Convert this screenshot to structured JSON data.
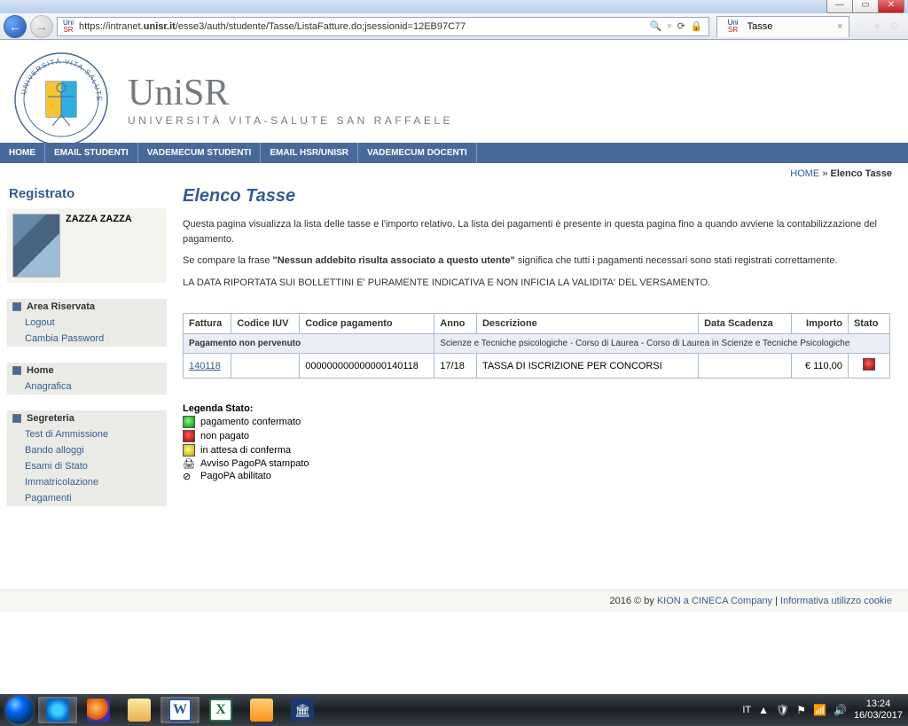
{
  "window": {
    "min": "—",
    "max": "▭",
    "close": "✕"
  },
  "browser": {
    "back": "←",
    "fwd": "→",
    "url_pre": "https://intranet.",
    "url_bold": "unisr.it",
    "url_post": "/esse3/auth/studente/Tasse/ListaFatture.do;jsessionid=12EB97C77",
    "search_glyph": "🔍",
    "refresh": "⟳",
    "lock": "🔒",
    "tab_title": "Tasse",
    "tab_close": "×",
    "home": "⌂",
    "star": "★",
    "gear": "⚙"
  },
  "brand": {
    "uni": "Uni",
    "sr": "SR",
    "big": "UniSR",
    "sub": "UNIVERSITÀ VITA-SALUTE SAN RAFFAELE"
  },
  "topnav": [
    "HOME",
    "EMAIL STUDENTI",
    "VADEMECUM STUDENTI",
    "EMAIL HSR/UNISR",
    "VADEMECUM DOCENTI"
  ],
  "breadcrumb": {
    "home": "HOME",
    "sep": " » ",
    "current": "Elenco Tasse"
  },
  "sidebar": {
    "registrato": "Registrato",
    "username": "ZAZZA ZAZZA",
    "sections": [
      {
        "title": "Area Riservata",
        "items": [
          "Logout",
          "Cambia Password"
        ]
      },
      {
        "title": "Home",
        "items": [
          "Anagrafica"
        ]
      },
      {
        "title": "Segreteria",
        "items": [
          "Test di Ammissione",
          "Bando alloggi",
          "Esami di Stato",
          "Immatricolazione",
          "Pagamenti"
        ]
      }
    ]
  },
  "content": {
    "title": "Elenco Tasse",
    "intro1": "Questa pagina visualizza la lista delle tasse e l'importo relativo. La lista dei pagamenti è presente in questa pagina fino a quando avviene la contabilizzazione del pagamento.",
    "intro2_pre": "Se compare la frase ",
    "intro2_bold": "\"Nessun addebito risulta associato a questo utente\"",
    "intro2_post": " significa che tutti i pagamenti necessari sono stati registrati correttamente.",
    "intro3": "LA DATA RIPORTATA SUI BOLLETTINI E' PURAMENTE INDICATIVA E NON INFICIA LA VALIDITA' DEL VERSAMENTO."
  },
  "table": {
    "headers": {
      "fattura": "Fattura",
      "iuv": "Codice IUV",
      "codp": "Codice pagamento",
      "anno": "Anno",
      "desc": "Descrizione",
      "scad": "Data Scadenza",
      "imp": "Importo",
      "stato": "Stato"
    },
    "group": {
      "label": "Pagamento non pervenuto",
      "desc": "Scienze e Tecniche psicologiche - Corso di Laurea - Corso di Laurea in Scienze e Tecniche Psicologiche"
    },
    "row": {
      "fattura": "140118",
      "iuv": "",
      "codp": "000000000000000140118",
      "anno": "17/18",
      "desc": "TASSA DI ISCRIZIONE PER CONCORSI",
      "scad": "",
      "imp": "€ 110,00"
    }
  },
  "legend": {
    "title": "Legenda Stato:",
    "items": [
      "pagamento confermato",
      "non pagato",
      "in attesa di conferma",
      "Avviso PagoPA stampato",
      "PagoPA abilitato"
    ]
  },
  "footer": {
    "copy": "2016 © by ",
    "kion": "KION a CINECA Company",
    "sep": " | ",
    "priv": "Informativa utilizzo cookie"
  },
  "taskbar": {
    "lang": "IT",
    "up": "▲",
    "clock_time": "13:24",
    "clock_date": "16/03/2017"
  }
}
